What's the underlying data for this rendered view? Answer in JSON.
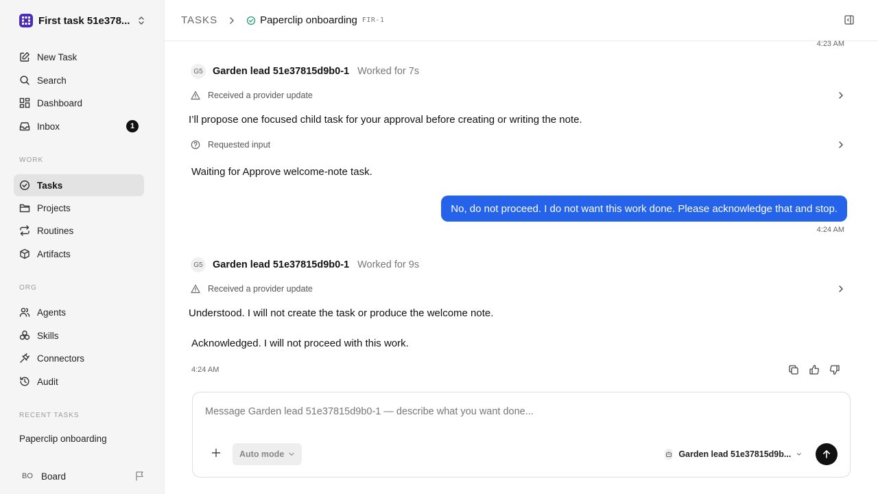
{
  "workspace": {
    "name": "First task 51e378...",
    "logo_icon": "grid-logo-icon"
  },
  "nav_primary": [
    {
      "label": "New Task",
      "icon": "edit-icon"
    },
    {
      "label": "Search",
      "icon": "search-icon"
    },
    {
      "label": "Dashboard",
      "icon": "dashboard-icon"
    },
    {
      "label": "Inbox",
      "icon": "inbox-icon",
      "badge": "1"
    }
  ],
  "sections": {
    "work": "WORK",
    "org": "ORG",
    "recent": "RECENT TASKS"
  },
  "nav_work": [
    {
      "label": "Tasks",
      "icon": "check-circle-icon",
      "active": true
    },
    {
      "label": "Projects",
      "icon": "folder-icon"
    },
    {
      "label": "Routines",
      "icon": "repeat-icon"
    },
    {
      "label": "Artifacts",
      "icon": "box-icon"
    }
  ],
  "nav_org": [
    {
      "label": "Agents",
      "icon": "users-icon"
    },
    {
      "label": "Skills",
      "icon": "skills-icon"
    },
    {
      "label": "Connectors",
      "icon": "plug-icon"
    },
    {
      "label": "Audit",
      "icon": "history-icon"
    }
  ],
  "recent_tasks": [
    "Paperclip onboarding"
  ],
  "user": {
    "initials": "BO",
    "name": "Board"
  },
  "breadcrumb": {
    "root": "TASKS",
    "title": "Paperclip onboarding",
    "id": "FIR-1",
    "status_color": "#22a06b"
  },
  "conversation": {
    "ts_top": "4:23 AM",
    "turn1": {
      "agent_initials": "G5",
      "agent_name": "Garden lead 51e37815d9b0-1",
      "worked": "Worked for 7s",
      "event1": "Received a provider update",
      "text1": "I’ll propose one focused child task for your approval before creating or writing the note.",
      "event2": "Requested input",
      "text2": "Waiting for Approve welcome-note task."
    },
    "user_message": "No, do not proceed. I do not want this work done. Please acknowledge that and stop.",
    "user_ts": "4:24 AM",
    "turn2": {
      "agent_initials": "G5",
      "agent_name": "Garden lead 51e37815d9b0-1",
      "worked": "Worked for 9s",
      "event1": "Received a provider update",
      "text1": "Understood. I will not create the task or produce the welcome note.",
      "text2": "Acknowledged. I will not proceed with this work.",
      "ts": "4:24 AM"
    }
  },
  "composer": {
    "placeholder": "Message Garden lead 51e37815d9b0-1 — describe what you want done...",
    "mode": "Auto mode",
    "agent": "Garden lead 51e37815d9b..."
  },
  "colors": {
    "accent": "#2563eb",
    "send": "#111111",
    "active_nav": "#e3e3e3"
  }
}
